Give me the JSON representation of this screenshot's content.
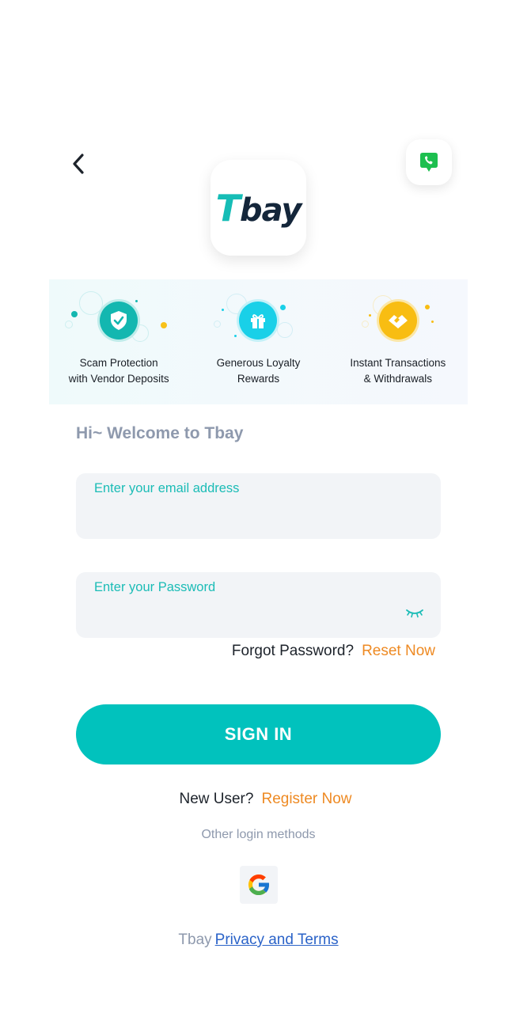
{
  "header": {
    "back_icon": "chevron-left-icon",
    "support_icon": "phone-chat-icon",
    "support_color": "#1dbf4f"
  },
  "logo": {
    "first_letter": "T",
    "rest": "bay",
    "first_color": "#16bdb6",
    "rest_color": "#14263a"
  },
  "features": [
    {
      "label_line1": "Scam Protection",
      "label_line2": "with Vendor Deposits",
      "icon": "shield-check-icon",
      "color": "#13b7b0"
    },
    {
      "label_line1": "Generous Loyalty",
      "label_line2": "Rewards",
      "icon": "gift-icon",
      "color": "#19d0e8"
    },
    {
      "label_line1": "Instant Transactions",
      "label_line2": "& Withdrawals",
      "icon": "handshake-icon",
      "color": "#f8bd12"
    }
  ],
  "welcome": "Hi~ Welcome to Tbay",
  "form": {
    "email_label": "Enter your email address",
    "email_value": "",
    "password_label": "Enter your Password",
    "password_value": "",
    "eye_icon": "eye-closed-icon"
  },
  "forgot": {
    "question": "Forgot Password?",
    "link": "Reset Now"
  },
  "sign_in_label": "SIGN IN",
  "register": {
    "question": "New User?",
    "link": "Register Now"
  },
  "other_methods": "Other login methods",
  "google_icon": "google-icon",
  "footer": {
    "brand": "Tbay",
    "link": "Privacy and Terms"
  },
  "colors": {
    "accent": "#01c2bd",
    "link_orange": "#ee8a23",
    "muted": "#8e99ad",
    "footer_link": "#2b63c8"
  }
}
